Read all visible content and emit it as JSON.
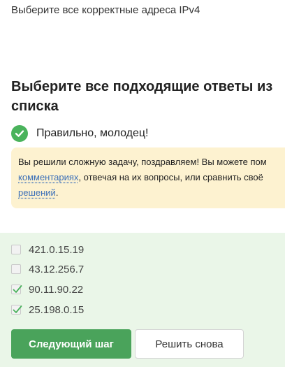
{
  "task": {
    "text": "Выберите все корректные адреса IPv4"
  },
  "quiz": {
    "title": "Выберите все подходящие ответы из списка",
    "status_text": "Правильно, молодец!",
    "feedback": {
      "line1": "Вы решили сложную задачу, поздравляем! Вы можете пом",
      "link_comments": "комментариях",
      "line2_rest": ", отвечая на их вопросы, или сравнить своё",
      "link_solutions": "решений",
      "line3_rest": "."
    },
    "options": [
      {
        "label": "421.0.15.19",
        "checked": false
      },
      {
        "label": "43.12.256.7",
        "checked": false
      },
      {
        "label": "90.11.90.22",
        "checked": true
      },
      {
        "label": "25.198.0.15",
        "checked": true
      }
    ],
    "buttons": {
      "next_label": "Следующий шаг",
      "retry_label": "Решить снова"
    }
  },
  "colors": {
    "success_green": "#4aa35b",
    "check_icon_green": "#4ab35c",
    "feedback_bg": "#fdf2d0",
    "answers_panel_bg": "#eaf6e8",
    "link_blue": "#3b6fb8"
  },
  "icons": {
    "status": "check-circle-icon",
    "option_check": "checkmark-icon"
  }
}
